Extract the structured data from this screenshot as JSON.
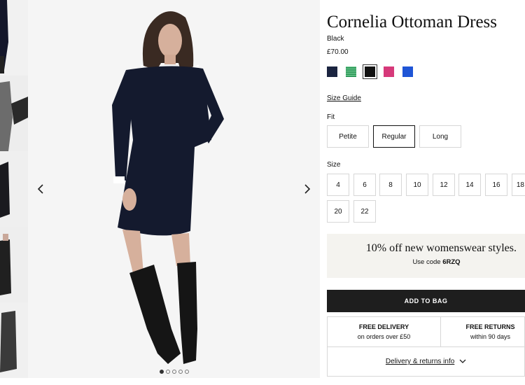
{
  "product": {
    "title": "Cornelia Ottoman Dress",
    "color_name": "Black",
    "price": "£70.00"
  },
  "swatches": [
    {
      "name": "navy",
      "color": "#1b2440"
    },
    {
      "name": "green-stripe",
      "color": "#2f9a5a"
    },
    {
      "name": "black",
      "color": "#111111"
    },
    {
      "name": "pink",
      "color": "#d6397a"
    },
    {
      "name": "blue",
      "color": "#1f55d6"
    }
  ],
  "selected_swatch": "black",
  "size_guide": "Size Guide",
  "fit": {
    "label": "Fit",
    "options": [
      "Petite",
      "Regular",
      "Long"
    ],
    "selected": "Regular"
  },
  "size": {
    "label": "Size",
    "options": [
      "4",
      "6",
      "8",
      "10",
      "12",
      "14",
      "16",
      "18",
      "20",
      "22"
    ]
  },
  "promo": {
    "headline": "10% off new womenswear styles.",
    "prefix": "Use code",
    "code": "6RZQ"
  },
  "add_to_bag": "ADD TO BAG",
  "info": {
    "delivery_title": "FREE DELIVERY",
    "delivery_sub": "on orders over £50",
    "returns_title": "FREE RETURNS",
    "returns_sub": "within 90 days",
    "link": "Delivery & returns info"
  },
  "gallery": {
    "dots": 5,
    "active_dot": 1
  }
}
